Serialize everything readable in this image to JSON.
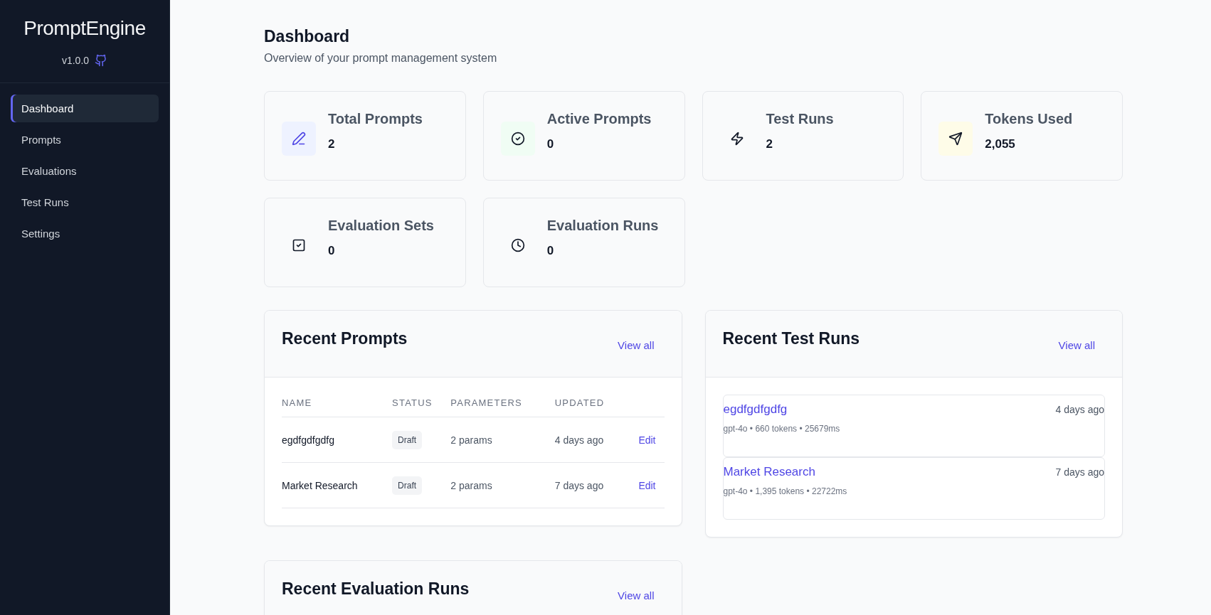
{
  "sidebar": {
    "brand": "PromptEngine",
    "version": "v1.0.0",
    "items": [
      {
        "label": "Dashboard",
        "selected": true
      },
      {
        "label": "Prompts",
        "selected": false
      },
      {
        "label": "Evaluations",
        "selected": false
      },
      {
        "label": "Test Runs",
        "selected": false
      },
      {
        "label": "Settings",
        "selected": false
      }
    ]
  },
  "page": {
    "title": "Dashboard",
    "subtitle": "Overview of your prompt management system"
  },
  "stats": [
    {
      "label": "Total Prompts",
      "value": "2",
      "color": "#eef2ff"
    },
    {
      "label": "Active Prompts",
      "value": "0",
      "color": "#f0fdf4"
    },
    {
      "label": "Test Runs",
      "value": "2"
    },
    {
      "label": "Tokens Used",
      "value": "2,055",
      "color": "#fefce8"
    },
    {
      "label": "Evaluation Sets",
      "value": "0"
    },
    {
      "label": "Evaluation Runs",
      "value": "0"
    }
  ],
  "recent_prompts": {
    "title": "Recent Prompts",
    "link": "View all",
    "columns": [
      "NAME",
      "STATUS",
      "PARAMETERS",
      "UPDATED"
    ],
    "rows": [
      {
        "name": "egdfgdfgdfg",
        "status": "Draft",
        "parameters": "2 params",
        "updated": "4 days ago",
        "action": "Edit"
      },
      {
        "name": "Market Research",
        "status": "Draft",
        "parameters": "2 params",
        "updated": "7 days ago",
        "action": "Edit"
      }
    ]
  },
  "recent_test_runs": {
    "title": "Recent Test Runs",
    "link": "View all",
    "runs": [
      {
        "name": "egdfgdfgdfg",
        "time": "4 days ago",
        "details": "gpt-4o • 660 tokens • 25679ms"
      },
      {
        "name": "Market Research",
        "time": "7 days ago",
        "details": "gpt-4o • 1,395 tokens • 22722ms"
      }
    ]
  },
  "recent_evaluation_runs": {
    "title": "Recent Evaluation Runs",
    "link": "View all"
  }
}
